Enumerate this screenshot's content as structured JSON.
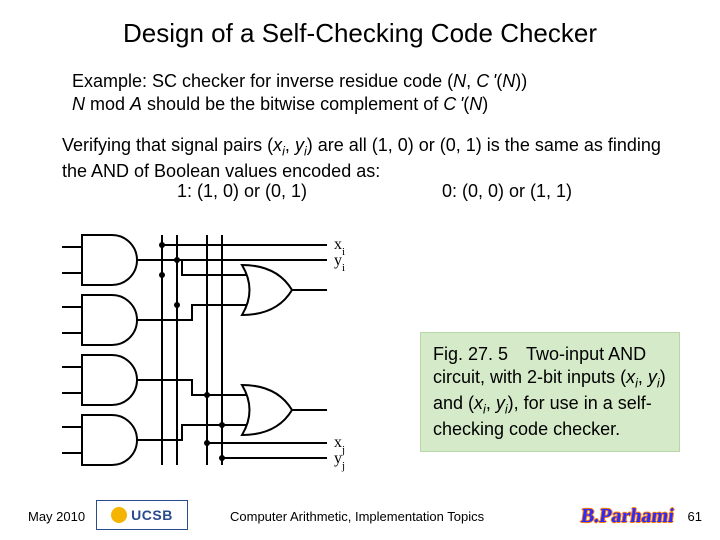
{
  "title": "Design of a Self-Checking Code Checker",
  "example": {
    "line1_prefix": "Example: SC checker for inverse residue code (",
    "N1": "N",
    "comma": ", ",
    "Cprime": "C '",
    "paren_open": "(",
    "N2": "N",
    "line1_suffix": "))",
    "line2_N": "N",
    "line2_mod": " mod ",
    "line2_A": "A",
    "line2_mid": " should be the bitwise complement of ",
    "line2_Cprime": "C '",
    "line2_N3": "N",
    "line2_close": ")"
  },
  "verify": {
    "prefix": "Verifying that signal pairs (",
    "xi": "x",
    "sep": ", ",
    "yi": "y",
    "suffix": ") are all (1, 0) or (0, 1) is the same as finding the AND of Boolean values encoded as:"
  },
  "encodings": {
    "one": "1: (1, 0) or (0, 1)",
    "zero": "0: (0, 0) or (1, 1)"
  },
  "figcap": {
    "fignum": "Fig. 27. 5",
    "gap": " ",
    "text1": "Two-input AND circuit, with 2-bit inputs (",
    "x1": "x",
    "y1": "y",
    "and": ") and (",
    "x2": "x",
    "y2": "y",
    "text2": "), for use in a self-checking code checker."
  },
  "circuit_labels": {
    "xi": "x",
    "yi": "y",
    "xj": "x",
    "yj": "y",
    "sub_i": "i",
    "sub_j": "j"
  },
  "footer": {
    "date": "May 2010",
    "center": "Computer Arithmetic, Implementation Topics",
    "ucsb": "UCSB",
    "author": "B.Parhami",
    "pagenum": "61"
  }
}
